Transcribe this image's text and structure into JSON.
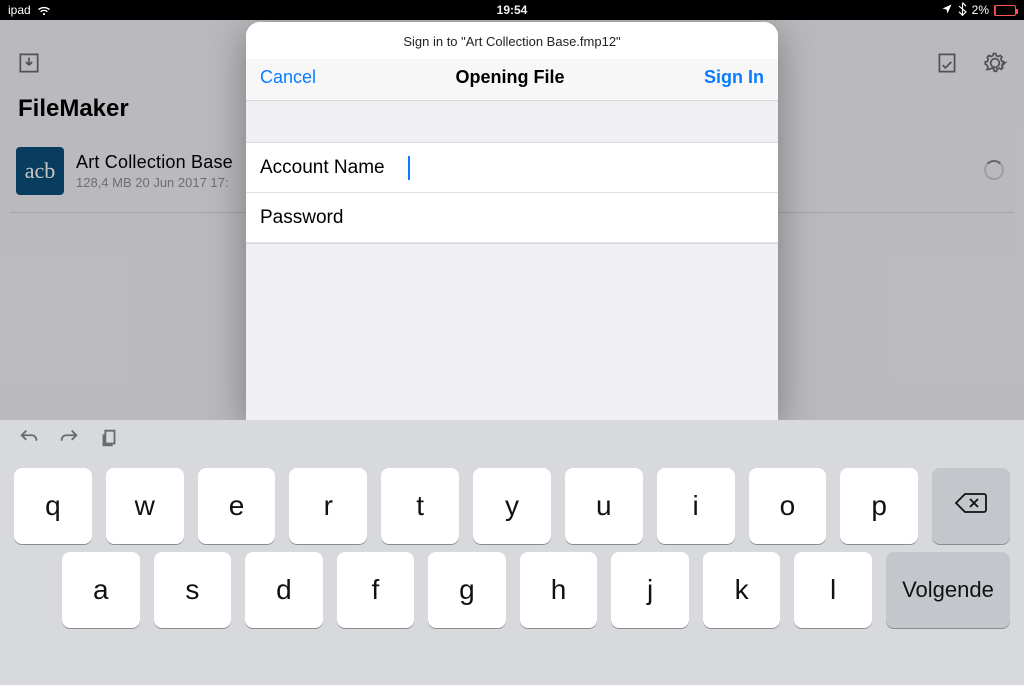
{
  "status": {
    "carrier": "ipad",
    "time": "19:54",
    "battery": "2%"
  },
  "app": {
    "title": "FileMaker"
  },
  "db_row": {
    "icon_text": "acb",
    "title": "Art Collection Base",
    "subtitle": "128,4 MB 20 Jun 2017 17:"
  },
  "modal": {
    "header": "Sign in to \"Art Collection Base.fmp12\"",
    "cancel": "Cancel",
    "title": "Opening File",
    "signin": "Sign In",
    "account_label": "Account Name",
    "password_label": "Password",
    "account_value": "",
    "password_value": ""
  },
  "keyboard": {
    "row1": [
      "q",
      "w",
      "e",
      "r",
      "t",
      "y",
      "u",
      "i",
      "o",
      "p"
    ],
    "row2": [
      "a",
      "s",
      "d",
      "f",
      "g",
      "h",
      "j",
      "k",
      "l"
    ],
    "next": "Volgende"
  }
}
